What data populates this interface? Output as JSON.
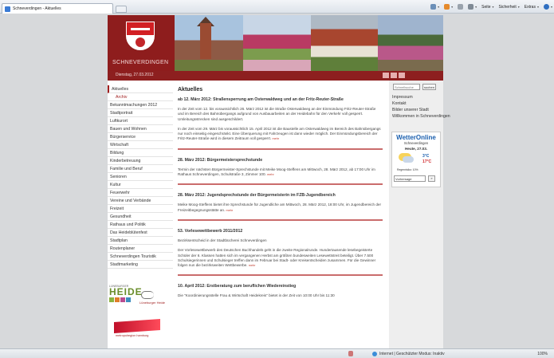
{
  "browser": {
    "tab_title": "Schneverdingen - Aktuelles",
    "commands": [
      "Seite",
      "Sicherheit",
      "Extras"
    ]
  },
  "header": {
    "brand": "SCHNEVERDINGEN",
    "date": "Dienstag, 27.03.2012"
  },
  "nav": {
    "items": [
      {
        "label": "Aktuelles",
        "active": true
      },
      {
        "label": "Archiv",
        "sub": true
      },
      {
        "label": "Bekanntmachungen 2012"
      },
      {
        "label": "Stadtportrait"
      },
      {
        "label": "Luftkurort"
      },
      {
        "label": "Bauen und Wohnen"
      },
      {
        "label": "Bürgerservice"
      },
      {
        "label": "Wirtschaft"
      },
      {
        "label": "Bildung"
      },
      {
        "label": "Kinderbetreuung"
      },
      {
        "label": "Familie und Beruf"
      },
      {
        "label": "Senioren"
      },
      {
        "label": "Kultur"
      },
      {
        "label": "Feuerwehr"
      },
      {
        "label": "Vereine und Verbände"
      },
      {
        "label": "Freizeit"
      },
      {
        "label": "Gesundheit"
      },
      {
        "label": "Rathaus und Politik"
      },
      {
        "label": "Das Heideblütenfest"
      },
      {
        "label": "Stadtplan"
      },
      {
        "label": "Routenplaner"
      },
      {
        "label": "Schneverdingen Touristik"
      },
      {
        "label": "Stadtmarketing"
      }
    ]
  },
  "logos": {
    "lh_small": "LÜNEBURGER",
    "lh_heide": "HEIDE",
    "lh_right": "Lüneburger Heide",
    "metro": "metropolregion hamburg"
  },
  "main": {
    "heading": "Aktuelles",
    "articles": [
      {
        "title": "ab 12. März 2012: Straßensperrung am Osterwaldweg und an der Fritz-Reuter-Straße",
        "paragraphs": [
          "In der Zeit vom 12. bis voraussichtlich 26. März 2012 ist die Straße Osterwaldweg an der Einmündung Fritz-Reuter-Straße und im Bereich des Bahnübergangs aufgrund von Ausbauarbeiten an der Heidebahn für den Verkehr voll gesperrt. Umleitungsstrecken sind ausgeschildert.",
          "In der Zeit vom 29. März bis voraussichtlich 15. April 2012 ist die Baustelle am Osterwaldweg im Bereich des Bahnübergangs nur noch einseitig eingeschränkt. Eine Überquerung mit Fahrzeugen ist dann wieder möglich. Der Einmündungsbereich der Fritz-Reuter-Straße wird in diesem Zeitraum voll gesperrt."
        ]
      },
      {
        "title": "28. März 2012: Bürgermeistersprechstunde",
        "paragraphs": [
          "Termin der nächsten Bürgermeister-Sprechstunde mit Meike Moog-Steffens am Mittwoch, 28. März 2012, ab 17:00 Uhr im Rathaus Schneverdingen, Schulstraße 3, Zimmer 100."
        ]
      },
      {
        "title": "28. März 2012: Jugendsprechstunde der Bürgermeisterin im FZB-Jugendbereich",
        "paragraphs": [
          "Meike Moog-Steffens bietet ihre Sprechstunde für Jugendliche am Mittwoch, 28. März 2012, 18:00 Uhr, im Jugendbereich der Freizeitbegegnungsstätte an."
        ]
      },
      {
        "title": "53. Vorlesewettbewerb 2011/2012",
        "paragraphs": [
          "Bezirksentscheid in der Stadtbücherei Schneverdingen",
          "Der Vorlesewettbewerb des Deutschen Buchhandels geht in die zweite Regionalrunde. Hundertausende lesebegeisterte Schüler der 6. Klassen hatten sich im vergangenen Herbst am größten bundesweiten Lesewettstreit beteiligt. Über 7.500 Schulsiegerinnen und Schulsieger treffen dann im Februar bei Stadt- oder Kreisentscheiden zusammen. Für die Gewinner folgen nun die bezirksweiten Wettbewerbe."
        ]
      },
      {
        "title": "10. April 2012: Erstberatung zum beruflichen Wiedereinstieg",
        "paragraphs": [
          "Die \"Koordinierungsstelle Frau & Wirtschaft Heidekreis\" bietet in der Zeit von 10:00 Uhr bis 11:30"
        ]
      }
    ],
    "more_label": "mehr"
  },
  "right": {
    "search_placeholder": "Schnellsuche",
    "search_button": "suchen",
    "links": [
      "Impressum",
      "Kontakt",
      "Bilder unserer Stadt",
      "Willkommen in Schneverdingen"
    ],
    "weather": {
      "logo": "WetterOnline",
      "city": "Schneverdingen",
      "date": "Heute, 27.03.",
      "temp_min": "3°C",
      "temp_max": "17°C",
      "rain": "Regenrisiko: 10%",
      "select": "Vorhersage"
    }
  },
  "status": {
    "zone": "Internet | Geschützter Modus: Inaktiv",
    "zoom": "100%"
  },
  "colors": {
    "brand_red": "#8e1d1d",
    "accent_red": "#c0392b"
  }
}
